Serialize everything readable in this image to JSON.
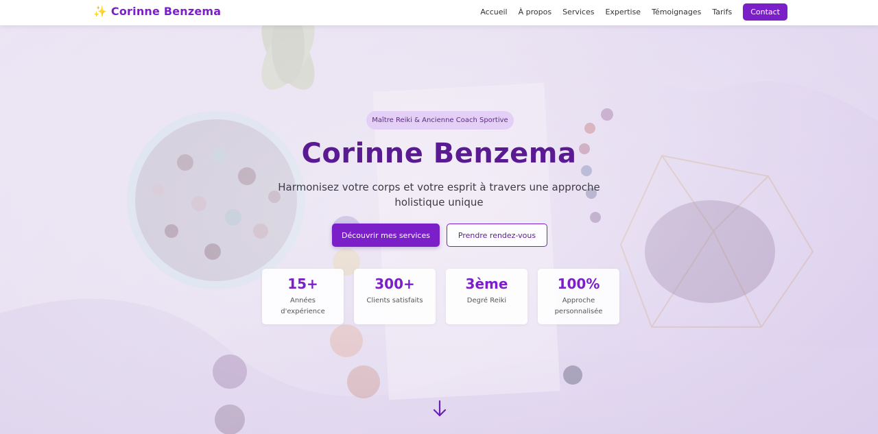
{
  "header": {
    "brand_icon": "sparkles-icon",
    "brand_name": "Corinne Benzema",
    "nav": [
      {
        "label": "Accueil"
      },
      {
        "label": "À propos"
      },
      {
        "label": "Services"
      },
      {
        "label": "Expertise"
      },
      {
        "label": "Témoignages"
      },
      {
        "label": "Tarifs"
      }
    ],
    "cta_label": "Contact"
  },
  "hero": {
    "badge": "Maître Reiki & Ancienne Coach Sportive",
    "title": "Corinne Benzema",
    "subtitle": "Harmonisez votre corps et votre esprit à travers une approche holistique unique",
    "primary_button": "Découvrir mes services",
    "secondary_button": "Prendre rendez-vous",
    "stats": [
      {
        "value": "15+",
        "label": "Années d'expérience"
      },
      {
        "value": "300+",
        "label": "Clients satisfaits"
      },
      {
        "value": "3ème",
        "label": "Degré Reiki"
      },
      {
        "value": "100%",
        "label": "Approche personnalisée"
      }
    ],
    "scroll_icon": "arrow-down-icon"
  },
  "colors": {
    "accent": "#7b1fc9",
    "title": "#5a1a91",
    "badge_bg": "#e2cdf6"
  }
}
